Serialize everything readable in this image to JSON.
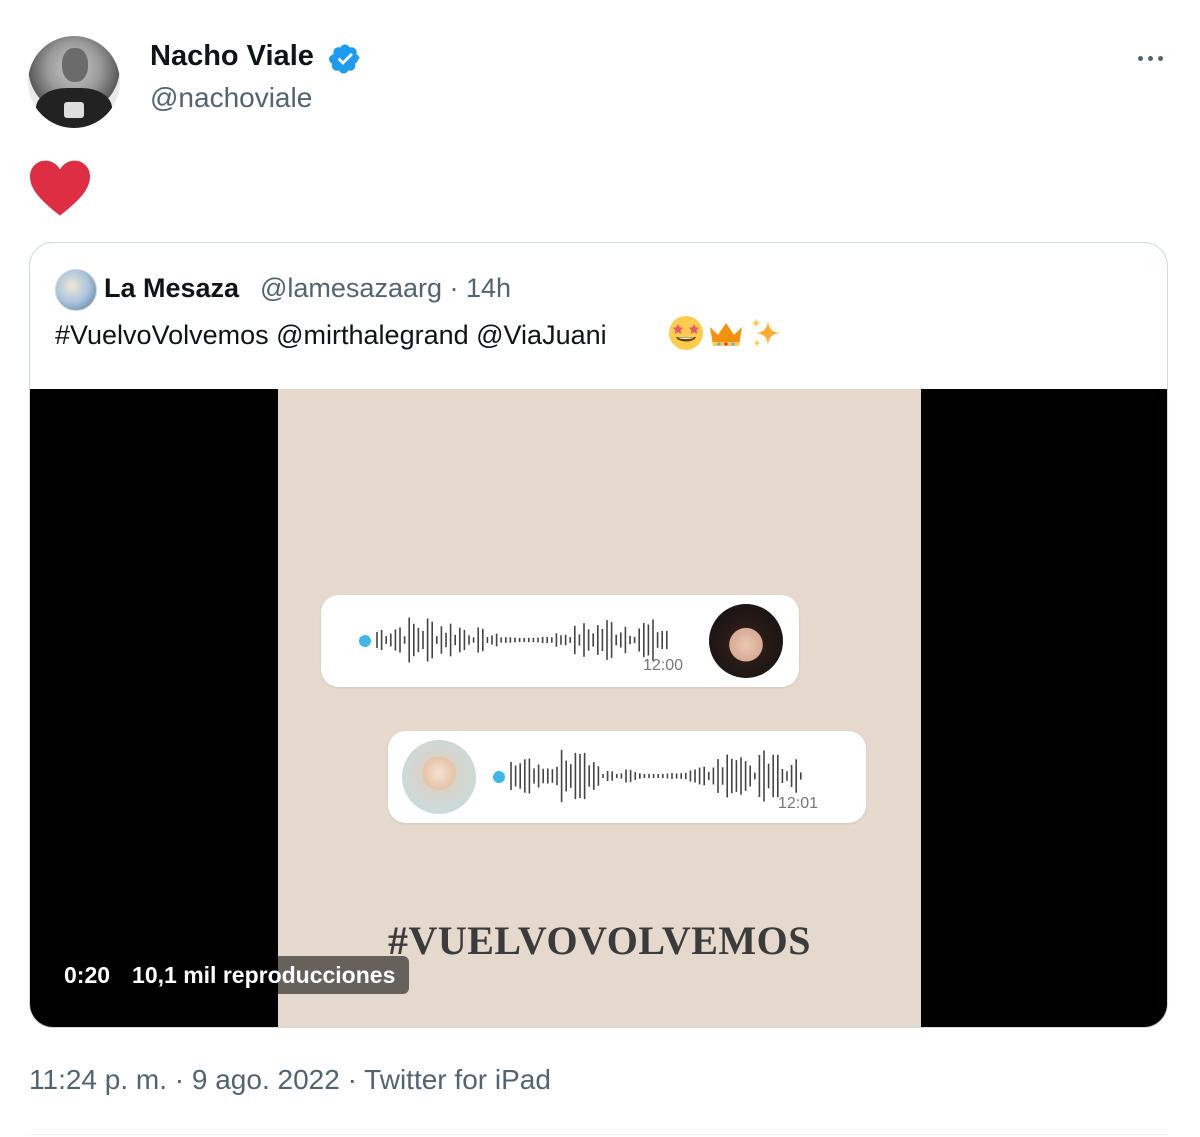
{
  "tweet": {
    "author_name": "Nacho Viale",
    "author_handle": "@nachoviale",
    "verified_icon": "verified-badge-icon",
    "more_icon": "more-options-icon",
    "body_emoji": "red-heart",
    "timestamp": "11:24 p. m.",
    "date": "9 ago. 2022",
    "source": "Twitter for iPad",
    "footer_text": "11:24 p. m. · 9 ago. 2022 · Twitter for iPad"
  },
  "quoted_tweet": {
    "author_name": "La Mesaza",
    "author_handle": "@lamesazaarg",
    "age": "14h",
    "meta_text": "@lamesazaarg · 14h",
    "text": "#VuelvoVolvemos @mirthalegrand @ViaJuani",
    "emojis": [
      "star-struck",
      "crown",
      "sparkles"
    ],
    "video": {
      "bubble1_time": "12:00",
      "bubble2_time": "12:01",
      "hashtag": "#VUELVOVOLVEMOS",
      "duration": "0:20",
      "views": "10,1 mil reproducciones"
    }
  },
  "colors": {
    "text_primary": "#0f1419",
    "text_secondary": "#536471",
    "verified": "#1d9bf0",
    "border": "#cfd9de",
    "video_frame": "#e5d8cc",
    "audio_dot": "#3fb7e8",
    "heart": "#dd2e44"
  }
}
